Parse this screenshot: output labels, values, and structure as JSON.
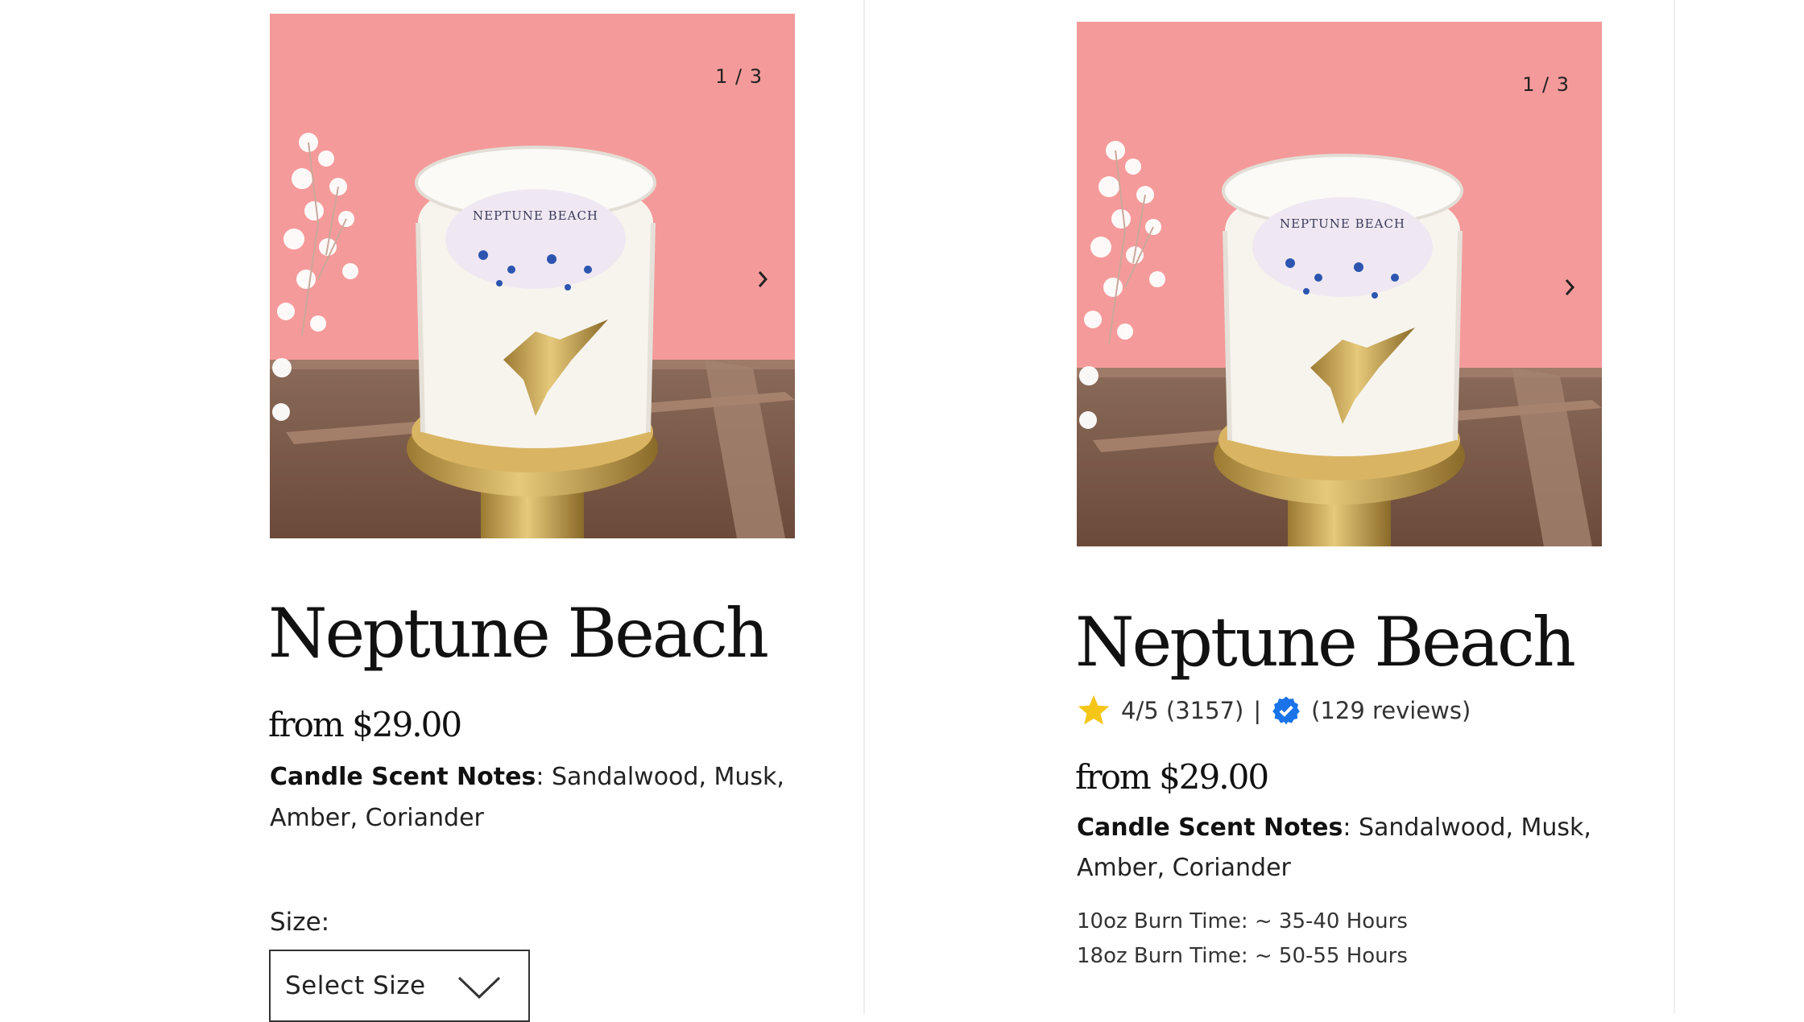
{
  "products": [
    {
      "slide_counter": "1 / 3",
      "image_label": "NEPTUNE BEACH",
      "title": "Neptune Beach",
      "price": "from $29.00",
      "scent_label": "Candle Scent Notes",
      "scent_colon": ":",
      "scent_notes": " Sandalwood, Musk, Amber, Coriander",
      "size_label": "Size:",
      "size_select_value": "Select Size"
    },
    {
      "slide_counter": "1 / 3",
      "image_label": "NEPTUNE BEACH",
      "title": "Neptune Beach",
      "rating": "4/5 (3157)",
      "rating_separator": "|",
      "reviews": "(129 reviews)",
      "price": "from $29.00",
      "scent_label": "Candle Scent Notes",
      "scent_colon": ":",
      "scent_notes": " Sandalwood, Musk, Amber, Coriander",
      "burn_times": [
        "10oz Burn Time: ~ 35-40 Hours",
        "18oz Burn Time: ~ 50-55 Hours"
      ]
    }
  ],
  "icons": {
    "star": "star-icon",
    "verified": "verified-badge-icon",
    "prev": "chevron-left-icon",
    "next": "chevron-right-icon",
    "dropdown": "chevron-down-icon"
  },
  "colors": {
    "image_background": "#f59a9a",
    "star": "#f5c518",
    "verified": "#1a73e8",
    "gold": "#c9a24a"
  }
}
